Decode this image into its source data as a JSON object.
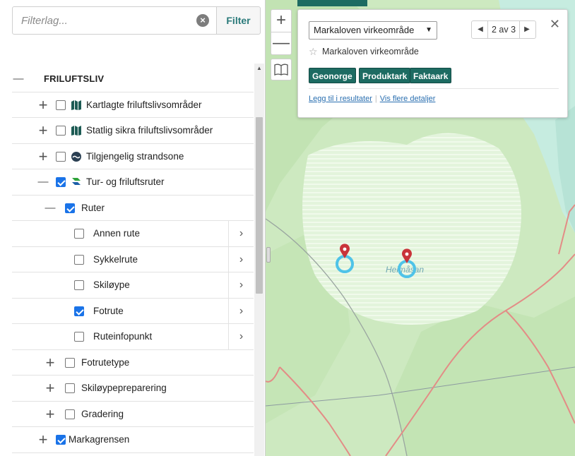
{
  "filter": {
    "placeholder": "Filterlag...",
    "button_label": "Filter"
  },
  "layers": [
    {
      "label": "FRILUFTSLIV",
      "level": 0,
      "toggle": "minus",
      "checkbox": "none",
      "icon": "none",
      "chevron": false
    },
    {
      "label": "Kartlagte friluftslivsområder",
      "level": 1,
      "toggle": "plus",
      "checkbox": "off",
      "icon": "map-book-icon",
      "chevron": false
    },
    {
      "label": "Statlig sikra friluftslivsområder",
      "level": 1,
      "toggle": "plus",
      "checkbox": "off",
      "icon": "map-book-icon",
      "chevron": false
    },
    {
      "label": "Tilgjengelig strandsone",
      "level": 1,
      "toggle": "plus",
      "checkbox": "off",
      "icon": "wave-icon",
      "chevron": false
    },
    {
      "label": "Tur- og friluftsruter",
      "level": 1,
      "toggle": "minus",
      "checkbox": "on",
      "icon": "route-logo-icon",
      "chevron": false
    },
    {
      "label": "Ruter",
      "level": 2,
      "toggle": "minus",
      "checkbox": "on",
      "icon": "none",
      "chevron": false
    },
    {
      "label": "Annen rute",
      "level": 3,
      "toggle": "none",
      "checkbox": "off",
      "icon": "none",
      "chevron": true
    },
    {
      "label": "Sykkelrute",
      "level": 3,
      "toggle": "none",
      "checkbox": "off",
      "icon": "none",
      "chevron": true
    },
    {
      "label": "Skiløype",
      "level": 3,
      "toggle": "none",
      "checkbox": "off",
      "icon": "none",
      "chevron": true
    },
    {
      "label": "Fotrute",
      "level": 3,
      "toggle": "none",
      "checkbox": "on",
      "icon": "none",
      "chevron": true
    },
    {
      "label": "Ruteinfopunkt",
      "level": 3,
      "toggle": "none",
      "checkbox": "off",
      "icon": "none",
      "chevron": true
    },
    {
      "label": "Fotrutetype",
      "level": 2,
      "toggle": "plus",
      "checkbox": "off",
      "icon": "none",
      "chevron": false
    },
    {
      "label": "Skiløypepreparering",
      "level": 2,
      "toggle": "plus",
      "checkbox": "off",
      "icon": "none",
      "chevron": false
    },
    {
      "label": "Gradering",
      "level": 2,
      "toggle": "plus",
      "checkbox": "off",
      "icon": "none",
      "chevron": false
    },
    {
      "label": "Markagrensen",
      "level": 1,
      "toggle": "plus",
      "checkbox": "on",
      "icon": "none",
      "chevron": false
    }
  ],
  "map": {
    "controls": {
      "zoom_in": "+",
      "zoom_out": "—"
    },
    "place_label": "Heimåsan",
    "colors": {
      "land": "#d8f0cf",
      "forest": "#c4e6b6",
      "water": "#bfe8df",
      "road": "#e38c86",
      "pin": "#c9343a",
      "pin_ring": "#4fc3e8",
      "hatch": "#eef8ea"
    }
  },
  "popup": {
    "select_value": "Markaloven virkeområde",
    "pager": "2 av 3",
    "close": "✕",
    "title": "Markaloven virkeområde",
    "buttons": [
      "Geonorge",
      "Produktark",
      "Faktaark"
    ],
    "links": [
      "Legg til i resultater",
      "Vis flere detaljer"
    ]
  },
  "theme": {
    "accent": "#1d6b62",
    "checkbox_on": "#1a73e8",
    "filter_text": "#2a7a7a"
  }
}
